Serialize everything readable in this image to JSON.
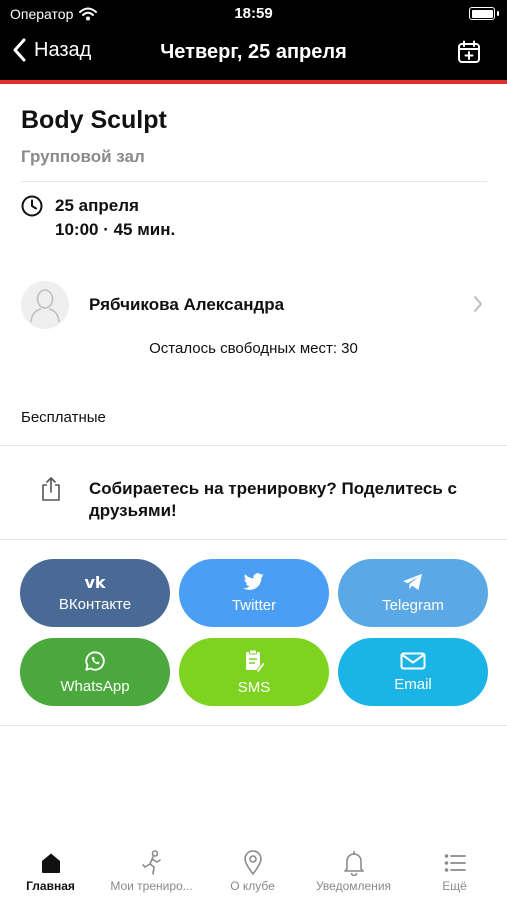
{
  "status_bar": {
    "carrier": "Оператор",
    "time": "18:59",
    "icons": [
      "wifi-icon",
      "battery-icon"
    ]
  },
  "nav": {
    "back_label": "Назад",
    "title": "Четверг, 25 апреля",
    "right_icon": "calendar-add-icon"
  },
  "colors": {
    "header_bg": "#000000",
    "accent_red": "#e0302b",
    "vk": "#4a6a96",
    "twitter": "#4a9ef3",
    "telegram": "#5aa9e6",
    "whatsapp": "#4aa83c",
    "sms": "#7ed321",
    "email": "#1ab4e6"
  },
  "class": {
    "title": "Body Sculpt",
    "place": "Групповой зал",
    "date": "25 апреля",
    "time_duration": "10:00 · 45 мин."
  },
  "trainer": {
    "name": "Рябчикова Александра",
    "icon": "person-icon"
  },
  "seats_text": "Осталось свободных мест: 30",
  "price_text": "Бесплатные",
  "share": {
    "icon": "share-icon",
    "text": "Собираетесь на тренировку? Поделитесь с друзьями!",
    "buttons": [
      {
        "label": "ВКонтакте",
        "icon": "vk-icon"
      },
      {
        "label": "Twitter",
        "icon": "twitter-icon"
      },
      {
        "label": "Telegram",
        "icon": "telegram-icon"
      },
      {
        "label": "WhatsApp",
        "icon": "whatsapp-icon"
      },
      {
        "label": "SMS",
        "icon": "sms-icon"
      },
      {
        "label": "Email",
        "icon": "email-icon"
      }
    ]
  },
  "tabbar": {
    "tabs": [
      {
        "label": "Главная",
        "icon": "home-icon",
        "active": true
      },
      {
        "label": "Мои трениро...",
        "icon": "runner-icon",
        "active": false
      },
      {
        "label": "О клубе",
        "icon": "location-pin-icon",
        "active": false
      },
      {
        "label": "Уведомления",
        "icon": "bell-icon",
        "active": false
      },
      {
        "label": "Ещё",
        "icon": "list-icon",
        "active": false
      }
    ]
  }
}
